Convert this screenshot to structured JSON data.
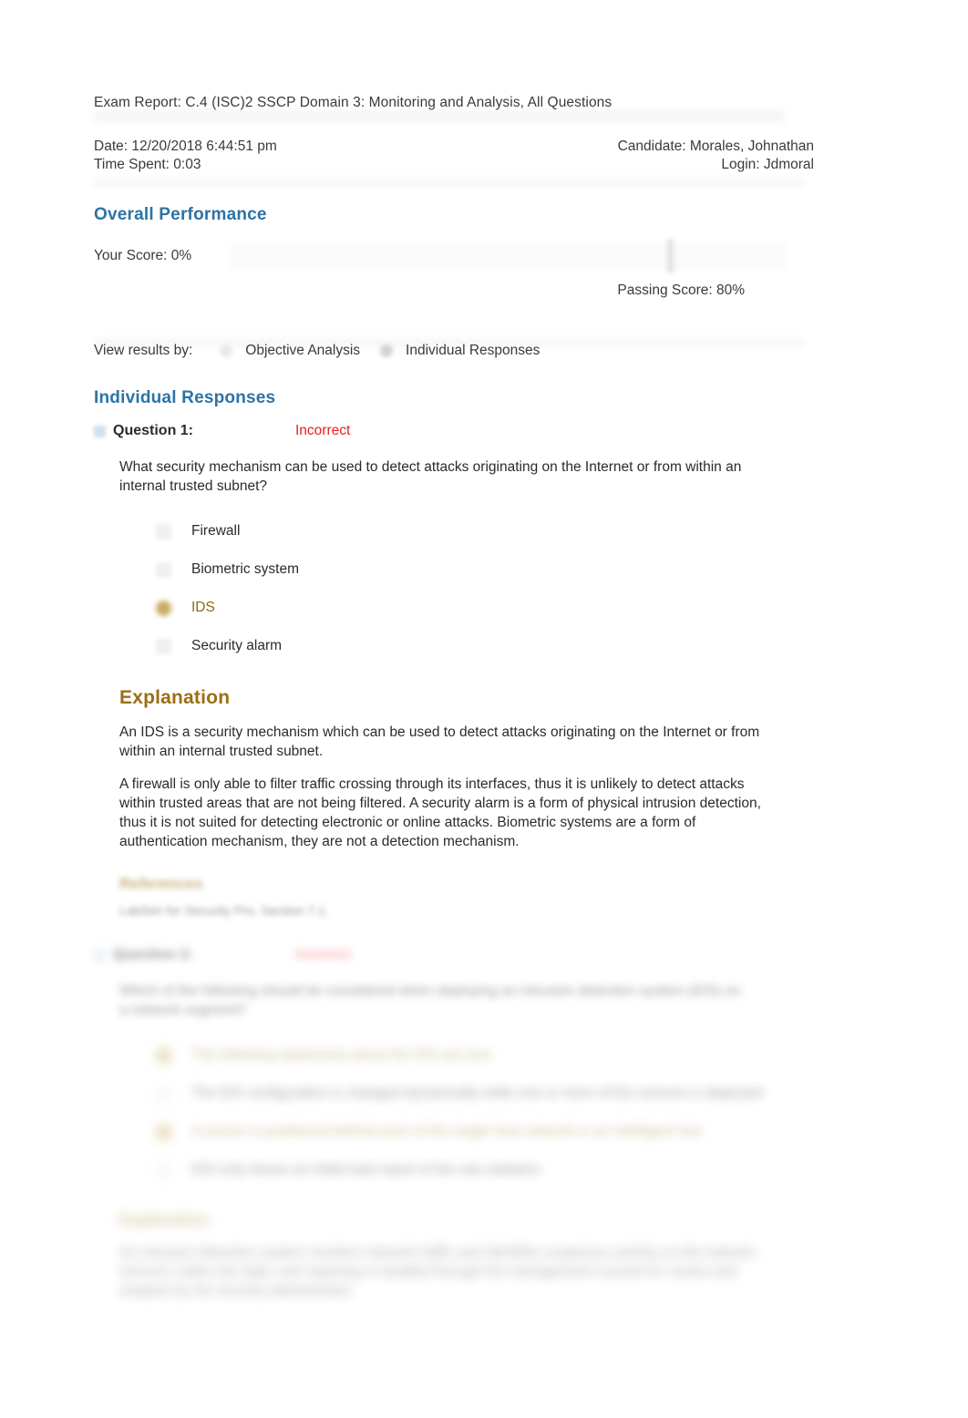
{
  "report": {
    "title": "Exam Report: C.4 (ISC)2 SSCP Domain 3: Monitoring and Analysis, All Questions",
    "date": "Date: 12/20/2018 6:44:51 pm",
    "time_spent": "Time Spent: 0:03",
    "candidate": "Candidate: Morales, Johnathan",
    "login": "Login: Jdmoral"
  },
  "overall_performance": {
    "heading": "Overall Performance",
    "your_score_label": "Your Score:  0%",
    "your_score_value": 0,
    "passing_score_label": "Passing Score: 80%",
    "passing_score_value": 80
  },
  "view_results_by": {
    "label": "View results by:",
    "options": [
      {
        "label": "Objective Analysis",
        "selected": false
      },
      {
        "label": "Individual Responses",
        "selected": true
      }
    ]
  },
  "individual_responses": {
    "heading": "Individual Responses",
    "questions": [
      {
        "label": "Question 1:",
        "status": "Incorrect",
        "text": "What security mechanism can be used to detect attacks originating on the Internet or from within an internal trusted subnet?",
        "answers": [
          {
            "text": "Firewall",
            "correct": false
          },
          {
            "text": "Biometric system",
            "correct": false
          },
          {
            "text": "IDS",
            "correct": true
          },
          {
            "text": "Security alarm",
            "correct": false
          }
        ],
        "explanation_heading": "Explanation",
        "explanation_paragraphs": [
          "An IDS is a security mechanism which can be used to detect attacks originating on the Internet or from within an internal trusted subnet.",
          "A firewall is only able to filter traffic crossing through its interfaces, thus it is unlikely to detect attacks within trusted areas that are not being filtered. A security alarm is a form of physical intrusion detection, thus it is not suited for detecting electronic or online attacks. Biometric systems are a form of authentication mechanism, they are not a detection mechanism."
        ],
        "references_heading": "References",
        "references_text": "LabSim for Security Pro, Section 7.1."
      },
      {
        "label": "Question 2:",
        "status": "Incorrect",
        "text": "Which of the following should be considered when deploying an intrusion detection system (IDS) on a network segment?",
        "answers": [
          {
            "text": "The following statements about the IDS are true",
            "correct": true
          },
          {
            "text": "The IDS configuration is changed dynamically while one or more of the sensors is deployed",
            "correct": false
          },
          {
            "text": "A sensor is positioned behind each of the single host network or an intelligent hub",
            "correct": true
          },
          {
            "text": "IDS only shows an initial load report of the raw statistics",
            "correct": false
          }
        ],
        "explanation_heading": "Explanation",
        "explanation_paragraphs": [
          "An intrusion detection system monitors network traffic and identifies suspicious activity on the network. Sensors collect the data, and reporting is handled through the management console for review and analysis by the security administrator."
        ]
      }
    ]
  }
}
